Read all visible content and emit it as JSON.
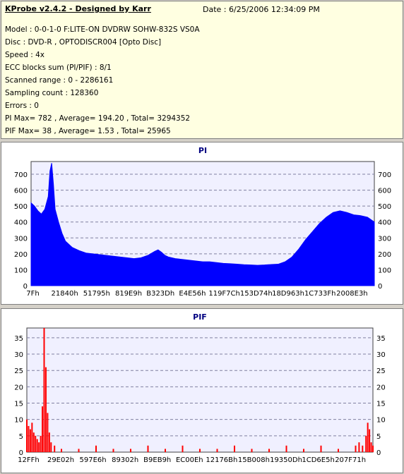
{
  "header": {
    "app_title": "KProbe v2.4.2 - Designed by Karr",
    "date": "Date : 6/25/2006 12:34:09 PM",
    "lines": [
      "Model : 0-0-1-0 F:LITE-ON DVDRW SOHW-832S  VS0A",
      "Disc : DVD-R , OPTODISCR004 [Opto Disc]",
      "Speed : 4x",
      "ECC blocks sum (PI/PIF) : 8/1",
      "Scanned range : 0 - 2286161",
      "Sampling count : 128360",
      "Errors : 0",
      "PI Max= 782 , Average= 194.20 , Total= 3294352",
      "PIF Max= 38 , Average= 1.53 , Total= 25965"
    ]
  },
  "chart_data": [
    {
      "type": "area",
      "title": "PI",
      "xlabel": "",
      "ylabel": "",
      "color": "#0000ff",
      "ylim": [
        0,
        780
      ],
      "yticks": [
        0,
        100,
        200,
        300,
        400,
        500,
        600,
        700
      ],
      "xticks": [
        "7Fh",
        "21840h",
        "51795h",
        "819E9h",
        "B323Dh",
        "E4E56h",
        "119F7Ch",
        "153D74h",
        "18D963h",
        "1C733Fh",
        "2008E3h"
      ],
      "grid": true,
      "x": [
        0,
        0.01,
        0.02,
        0.03,
        0.04,
        0.05,
        0.055,
        0.06,
        0.065,
        0.07,
        0.08,
        0.09,
        0.1,
        0.12,
        0.14,
        0.16,
        0.18,
        0.2,
        0.22,
        0.24,
        0.26,
        0.28,
        0.3,
        0.32,
        0.34,
        0.36,
        0.37,
        0.38,
        0.39,
        0.4,
        0.42,
        0.44,
        0.46,
        0.48,
        0.5,
        0.52,
        0.54,
        0.56,
        0.58,
        0.6,
        0.62,
        0.64,
        0.66,
        0.68,
        0.7,
        0.72,
        0.74,
        0.76,
        0.78,
        0.8,
        0.82,
        0.84,
        0.86,
        0.88,
        0.9,
        0.92,
        0.94,
        0.96,
        0.98,
        1.0
      ],
      "y": [
        520,
        500,
        470,
        450,
        480,
        560,
        720,
        770,
        640,
        480,
        400,
        330,
        280,
        240,
        220,
        205,
        200,
        195,
        190,
        185,
        180,
        175,
        170,
        175,
        190,
        215,
        225,
        210,
        190,
        180,
        170,
        165,
        160,
        155,
        150,
        150,
        145,
        140,
        138,
        135,
        132,
        130,
        128,
        130,
        133,
        135,
        150,
        180,
        230,
        290,
        340,
        390,
        430,
        460,
        470,
        460,
        445,
        440,
        430,
        400
      ]
    },
    {
      "type": "bar",
      "title": "PIF",
      "xlabel": "",
      "ylabel": "",
      "color": "#ff0000",
      "ylim": [
        0,
        38
      ],
      "yticks": [
        0,
        5,
        10,
        15,
        20,
        25,
        30,
        35
      ],
      "xticks": [
        "12FFh",
        "29E02h",
        "597E6h",
        "89302h",
        "B9EB9h",
        "EC00Eh",
        "12176Bh",
        "15B008h",
        "19350Dh",
        "1CD6E5h",
        "207F71h"
      ],
      "grid": true,
      "x": [
        0,
        0.005,
        0.01,
        0.015,
        0.02,
        0.025,
        0.03,
        0.035,
        0.04,
        0.045,
        0.05,
        0.055,
        0.06,
        0.065,
        0.07,
        0.08,
        0.1,
        0.15,
        0.2,
        0.25,
        0.3,
        0.35,
        0.4,
        0.45,
        0.5,
        0.55,
        0.6,
        0.65,
        0.7,
        0.75,
        0.8,
        0.85,
        0.9,
        0.95,
        0.96,
        0.97,
        0.98,
        0.985,
        0.99,
        0.995,
        1.0
      ],
      "y": [
        10,
        8,
        7,
        9,
        6,
        5,
        4,
        3,
        5,
        14,
        38,
        26,
        12,
        6,
        3,
        2,
        1,
        1,
        2,
        1,
        1,
        2,
        1,
        2,
        1,
        1,
        2,
        1,
        1,
        2,
        1,
        2,
        1,
        2,
        3,
        2,
        5,
        9,
        7,
        3,
        2
      ]
    }
  ]
}
